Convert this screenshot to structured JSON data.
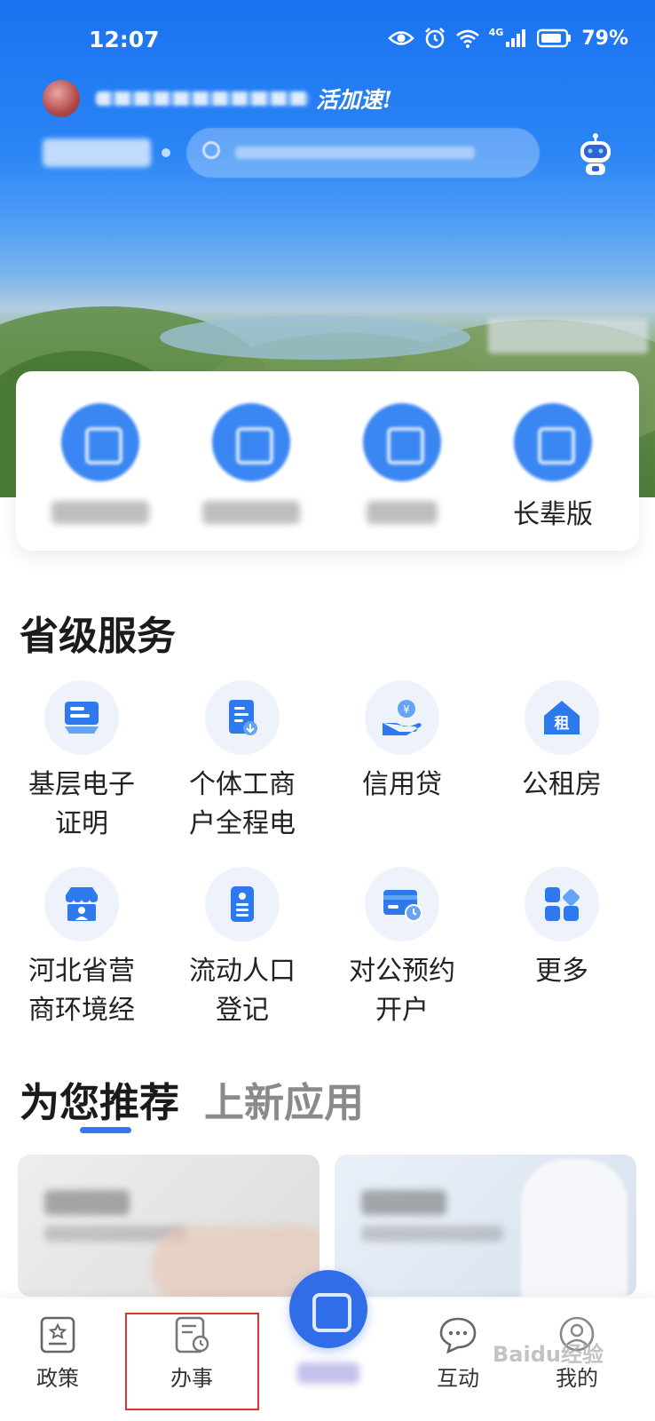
{
  "status_bar": {
    "time": "12:07",
    "network": "4G",
    "battery": "79%"
  },
  "header": {
    "greeting_suffix": "活加速!"
  },
  "quick_actions": [
    {
      "label": ""
    },
    {
      "label": ""
    },
    {
      "label": ""
    },
    {
      "label": "长辈版"
    }
  ],
  "provincial_services": {
    "title": "省级服务",
    "items": [
      {
        "label": "基层电子\n证明",
        "icon": "certificate-icon"
      },
      {
        "label": "个体工商\n户全程电",
        "icon": "document-download-icon"
      },
      {
        "label": "信用贷",
        "icon": "loan-hand-icon"
      },
      {
        "label": "公租房",
        "icon": "rent-house-icon"
      },
      {
        "label": "河北省营\n商环境经",
        "icon": "business-shop-icon"
      },
      {
        "label": "流动人口\n登记",
        "icon": "id-card-icon"
      },
      {
        "label": "对公预约\n开户",
        "icon": "bank-card-clock-icon"
      },
      {
        "label": "更多",
        "icon": "grid-more-icon"
      }
    ]
  },
  "recommend_tabs": {
    "active": "为您推荐",
    "inactive": "上新应用"
  },
  "bottom_nav": {
    "items": [
      "政策",
      "办事",
      "互动",
      "我的"
    ]
  },
  "watermark": "Baidu经验",
  "colors": {
    "primary": "#1a73f0",
    "accent": "#3478f0",
    "highlight": "#d9362b"
  }
}
